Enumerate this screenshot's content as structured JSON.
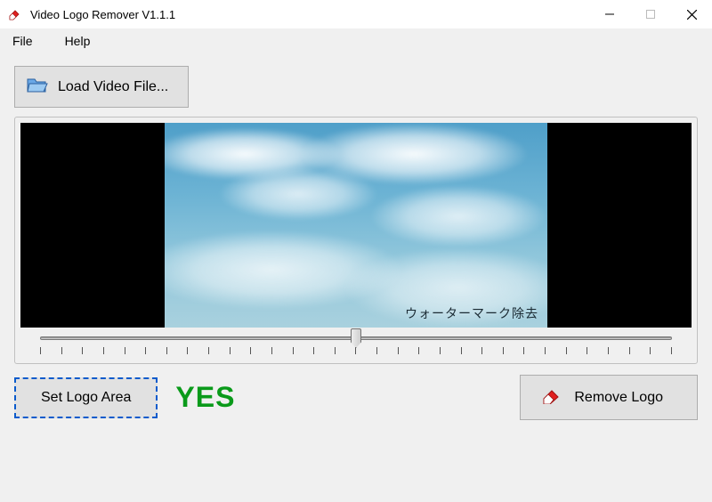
{
  "window": {
    "title": "Video Logo Remover V1.1.1",
    "icon_name": "app-eraser-icon",
    "buttons": {
      "min_glyph": "—",
      "max_glyph": "□",
      "close_glyph": "✕"
    }
  },
  "menu": {
    "file": "File",
    "help": "Help"
  },
  "toolbar": {
    "load_label": "Load Video File...",
    "load_icon_name": "open-folder-icon"
  },
  "preview": {
    "watermark_text": "ウォーターマーク除去",
    "slider_percent": 50,
    "tick_count": 31
  },
  "actions": {
    "set_area_label": "Set Logo Area",
    "status_text": "YES",
    "remove_label": "Remove Logo",
    "remove_icon_name": "eraser-icon"
  }
}
